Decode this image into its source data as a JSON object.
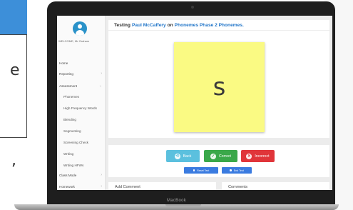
{
  "background": {
    "letter": "e",
    "comma": ","
  },
  "laptop": {
    "brand": "MacBook"
  },
  "sidebar": {
    "welcome": "WELCOME, Mr Graham",
    "items": [
      {
        "label": "Home",
        "chevron": ""
      },
      {
        "label": "Reporting",
        "chevron": "›"
      },
      {
        "label": "Assessment",
        "chevron": "⌄"
      },
      {
        "label": "Phonemes",
        "chevron": ""
      },
      {
        "label": "High Frequency Words",
        "chevron": ""
      },
      {
        "label": "Blending",
        "chevron": ""
      },
      {
        "label": "Segmenting",
        "chevron": ""
      },
      {
        "label": "Screening Check",
        "chevron": ""
      },
      {
        "label": "Writing",
        "chevron": ""
      },
      {
        "label": "Writing HFWs",
        "chevron": ""
      },
      {
        "label": "Class Mode",
        "chevron": "›"
      },
      {
        "label": "Homework",
        "chevron": "›"
      }
    ]
  },
  "header": {
    "prefix": "Testing",
    "student": "Paul McCaffery",
    "middle": "on",
    "test": "Phonemes Phase 2 Phonemes."
  },
  "card": {
    "phoneme": "s"
  },
  "actions": {
    "back": "Back",
    "correct": "Correct",
    "incorrect": "Incorrect",
    "back_icon": "⟲",
    "correct_icon": "✓",
    "incorrect_icon": "✕",
    "reset": "Reset Test",
    "end": "End Test"
  },
  "panels": {
    "add_comment": "Add Comment",
    "comments": "Comments"
  },
  "colors": {
    "back": "#5bc0de",
    "correct": "#3aa84a",
    "incorrect": "#e0353a",
    "small_buttons": "#3a7be0",
    "link": "#2276c9",
    "card": "#fafa83"
  }
}
